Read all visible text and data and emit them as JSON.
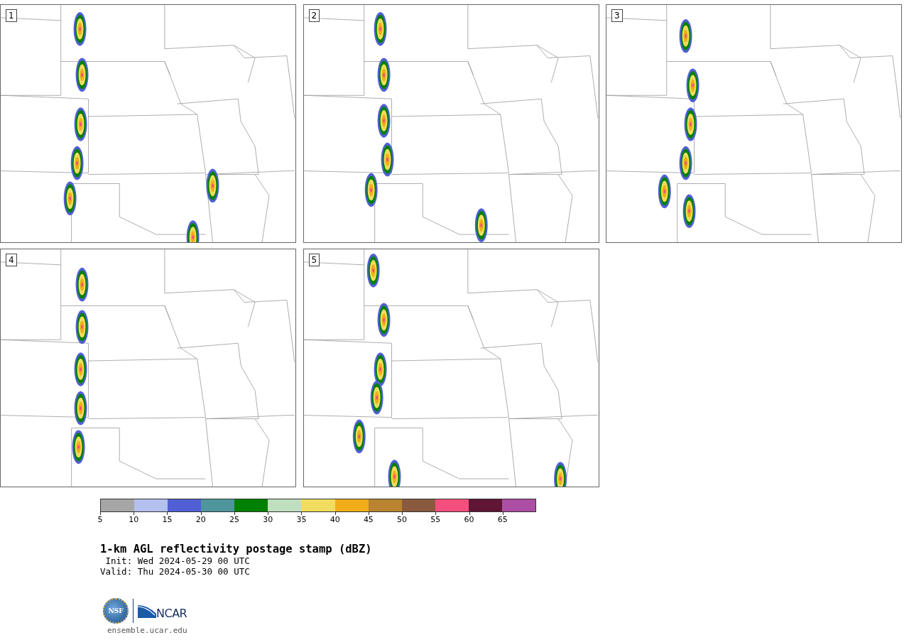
{
  "panels": [
    {
      "label": "1"
    },
    {
      "label": "2"
    },
    {
      "label": "3"
    },
    {
      "label": "4"
    },
    {
      "label": "5"
    }
  ],
  "colorbar": {
    "bins": [
      {
        "color": "#a6a6a6"
      },
      {
        "color": "#b4c0ed"
      },
      {
        "color": "#5060d4"
      },
      {
        "color": "#4f969c"
      },
      {
        "color": "#008000"
      },
      {
        "color": "#bfdfbf"
      },
      {
        "color": "#f0dc5f"
      },
      {
        "color": "#f0ad19"
      },
      {
        "color": "#b9832f"
      },
      {
        "color": "#8a5a3e"
      },
      {
        "color": "#f5507d"
      },
      {
        "color": "#601535"
      },
      {
        "color": "#ab4ea4"
      }
    ],
    "ticks": [
      "5",
      "10",
      "15",
      "20",
      "25",
      "30",
      "35",
      "40",
      "45",
      "50",
      "55",
      "60",
      "65"
    ]
  },
  "title": "1-km AGL reflectivity postage stamp (dBZ)",
  "init": " Init: Wed 2024-05-29 00 UTC",
  "valid": "Valid: Thu 2024-05-30 00 UTC",
  "logos": {
    "nsf": "NSF",
    "ncar": "NCAR"
  },
  "url": "ensemble.ucar.edu"
}
